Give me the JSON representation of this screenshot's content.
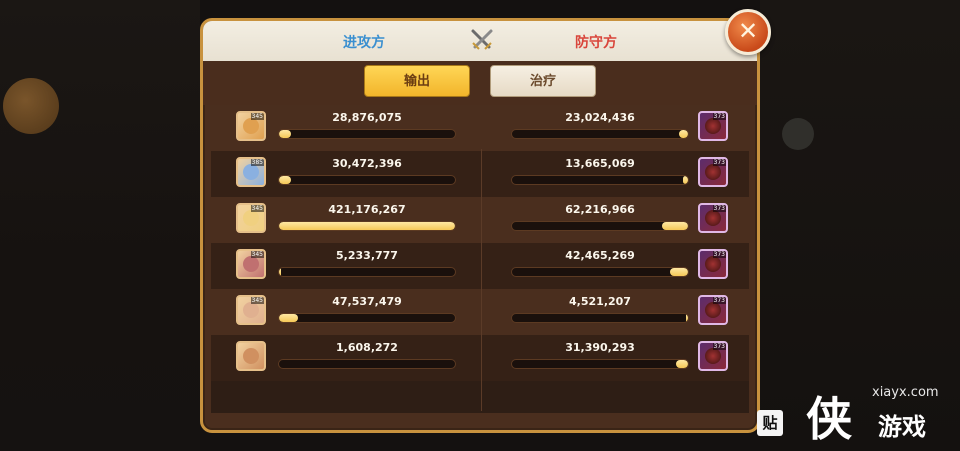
{
  "header": {
    "attack_title": "进攻方",
    "defend_title": "防守方"
  },
  "tabs": [
    {
      "label": "输出",
      "active": true
    },
    {
      "label": "治疗",
      "active": false
    }
  ],
  "rows": [
    {
      "attacker": {
        "value": "28,876,075",
        "fill": 0.07,
        "level": "345"
      },
      "defender": {
        "value": "23,024,436",
        "fill": 0.05,
        "level": "373"
      }
    },
    {
      "attacker": {
        "value": "30,472,396",
        "fill": 0.07,
        "level": "385"
      },
      "defender": {
        "value": "13,665,069",
        "fill": 0.03,
        "level": "373"
      }
    },
    {
      "attacker": {
        "value": "421,176,267",
        "fill": 1.0,
        "level": "345"
      },
      "defender": {
        "value": "62,216,966",
        "fill": 0.15,
        "level": "373"
      }
    },
    {
      "attacker": {
        "value": "5,233,777",
        "fill": 0.01,
        "level": "345"
      },
      "defender": {
        "value": "42,465,269",
        "fill": 0.1,
        "level": "373"
      }
    },
    {
      "attacker": {
        "value": "47,537,479",
        "fill": 0.11,
        "level": "345"
      },
      "defender": {
        "value": "4,521,207",
        "fill": 0.01,
        "level": "373"
      }
    },
    {
      "attacker": {
        "value": "1,608,272",
        "fill": 0.0,
        "level": ""
      },
      "defender": {
        "value": "31,390,293",
        "fill": 0.07,
        "level": "373"
      }
    }
  ],
  "watermark": {
    "url": "xiayx.com",
    "brand": "游戏",
    "logo": "侠",
    "tie_label": "贴"
  },
  "colors": {
    "attack": "#3a8fd0",
    "defend": "#d9453b",
    "bar_fill": "#f5c857",
    "panel_border": "#c8923e"
  },
  "icons": {
    "close": "close-icon",
    "versus": "crossed-swords-icon"
  }
}
